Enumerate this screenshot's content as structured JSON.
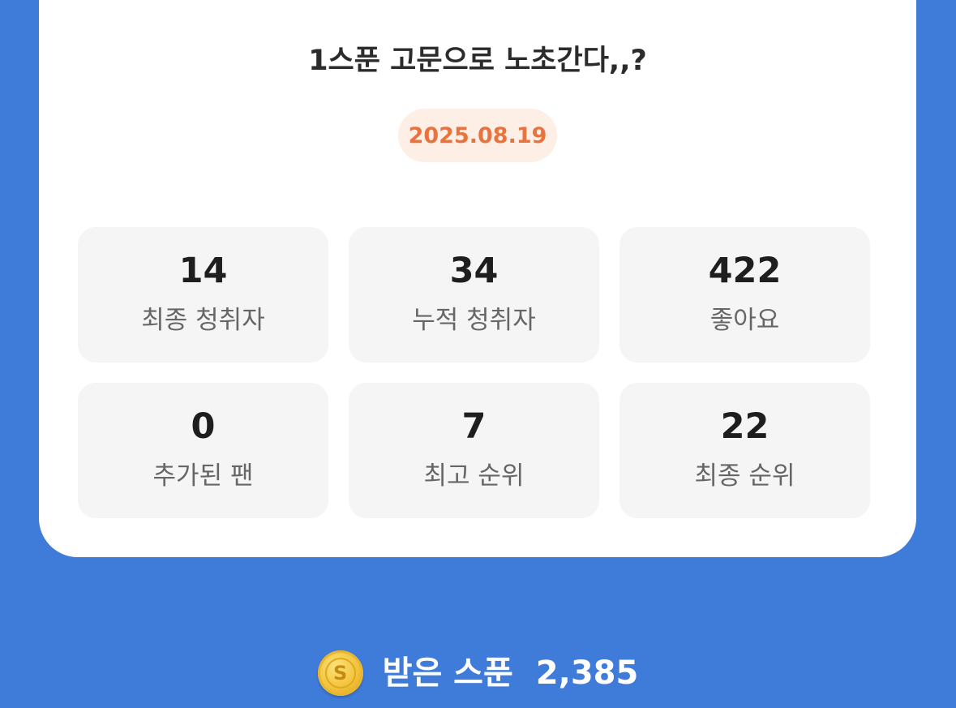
{
  "card": {
    "title": "1스푼 고문으로 노초간다,,?",
    "date": "2025.08.19"
  },
  "stats": [
    {
      "value": "14",
      "label": "최종 청취자"
    },
    {
      "value": "34",
      "label": "누적 청취자"
    },
    {
      "value": "422",
      "label": "좋아요"
    },
    {
      "value": "0",
      "label": "추가된 팬"
    },
    {
      "value": "7",
      "label": "최고 순위"
    },
    {
      "value": "22",
      "label": "최종 순위"
    }
  ],
  "received": {
    "label": "받은 스푼",
    "value": "2,385",
    "icon": "spoon-coin-icon",
    "coin_letter": "S"
  },
  "colors": {
    "background": "#3f7bd9",
    "date_text": "#e8733d",
    "date_bg": "#fdeee6"
  }
}
